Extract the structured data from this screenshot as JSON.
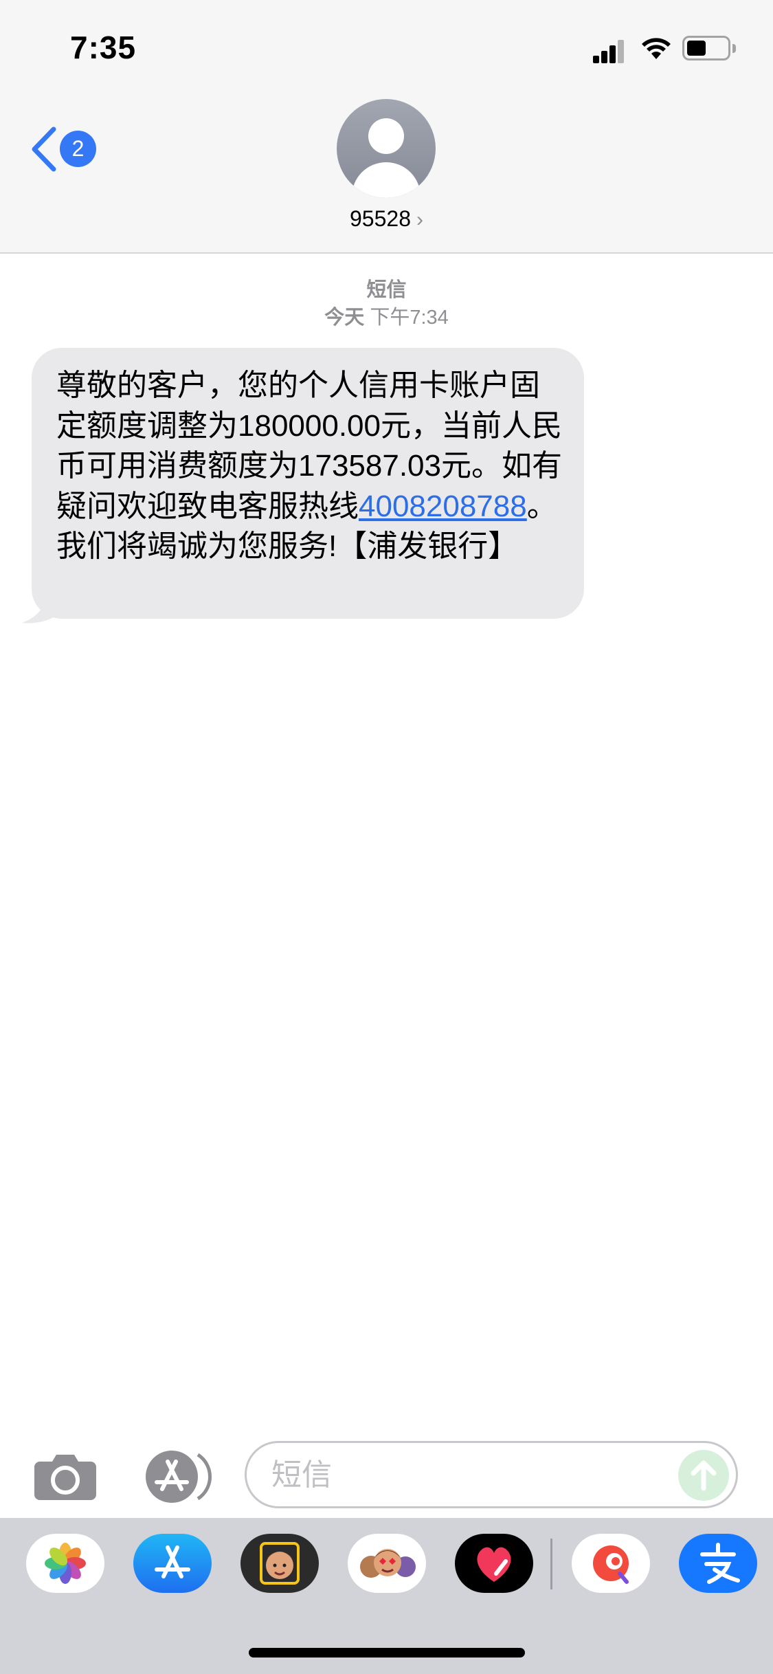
{
  "status_bar": {
    "time": "7:35"
  },
  "nav": {
    "unread_count": "2",
    "contact_name": "95528",
    "contact_chevron": "›"
  },
  "conversation": {
    "service_label": "短信",
    "date_day": "今天",
    "date_time": "下午7:34",
    "message": {
      "text_before_link": "尊敬的客户，您的个人信用卡账户固定额度调整为180000.00元，当前人民币可用消费额度为173587.03元。如有疑问欢迎致电客服热线",
      "phone_link": "4008208788",
      "text_after_link": "。我们将竭诚为您服务!【浦发银行】"
    }
  },
  "input_bar": {
    "placeholder": "短信"
  },
  "icons": {
    "back": "chevron-left-icon",
    "camera": "camera-icon",
    "app_store": "app-store-icon",
    "send": "send-arrow-icon"
  },
  "app_drawer": {
    "apps": [
      "photos",
      "app-store",
      "memoji-stickers",
      "animoji-stickers",
      "digital-touch",
      "app-6",
      "alipay"
    ]
  },
  "colors": {
    "accent": "#3478f6",
    "bubble": "#e9e9eb",
    "link": "#2c6ee8",
    "send_disabled": "#d7f0dc"
  }
}
